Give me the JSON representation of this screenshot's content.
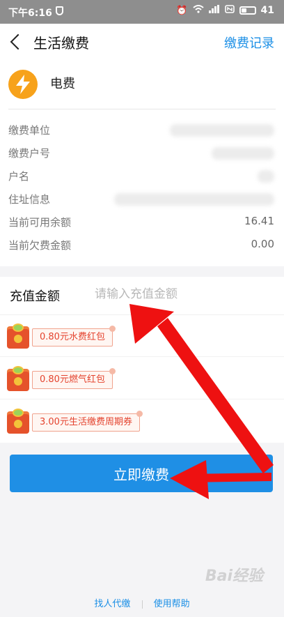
{
  "status_bar": {
    "time": "下午6:16",
    "battery_level": "41",
    "battery_fraction": 0.41
  },
  "nav": {
    "title": "生活缴费",
    "record_link": "缴费记录"
  },
  "bill": {
    "name": "电费",
    "icon": "lightning-bolt-icon",
    "icon_color": "#f7a21b"
  },
  "info_rows": [
    {
      "label": "缴费单位",
      "value": ""
    },
    {
      "label": "缴费户号",
      "value": ""
    },
    {
      "label": "户名",
      "value": ""
    },
    {
      "label": "住址信息",
      "value": ""
    },
    {
      "label": "当前可用余额",
      "value": "16.41"
    },
    {
      "label": "当前欠费金额",
      "value": "0.00"
    }
  ],
  "recharge": {
    "label": "充值金额",
    "placeholder": "请输入充值金额",
    "value": ""
  },
  "coupons": [
    {
      "text": "0.80元水费红包"
    },
    {
      "text": "0.80元燃气红包"
    },
    {
      "text": "3.00元生活缴费周期券"
    }
  ],
  "pay_button": "立即缴费",
  "footer": {
    "link1": "找人代缴",
    "link2": "使用帮助"
  },
  "watermark": "Bai经验",
  "colors": {
    "accent": "#1f8fe5",
    "coupon_red": "#e4432e",
    "annotation_arrow": "#ee1111"
  }
}
